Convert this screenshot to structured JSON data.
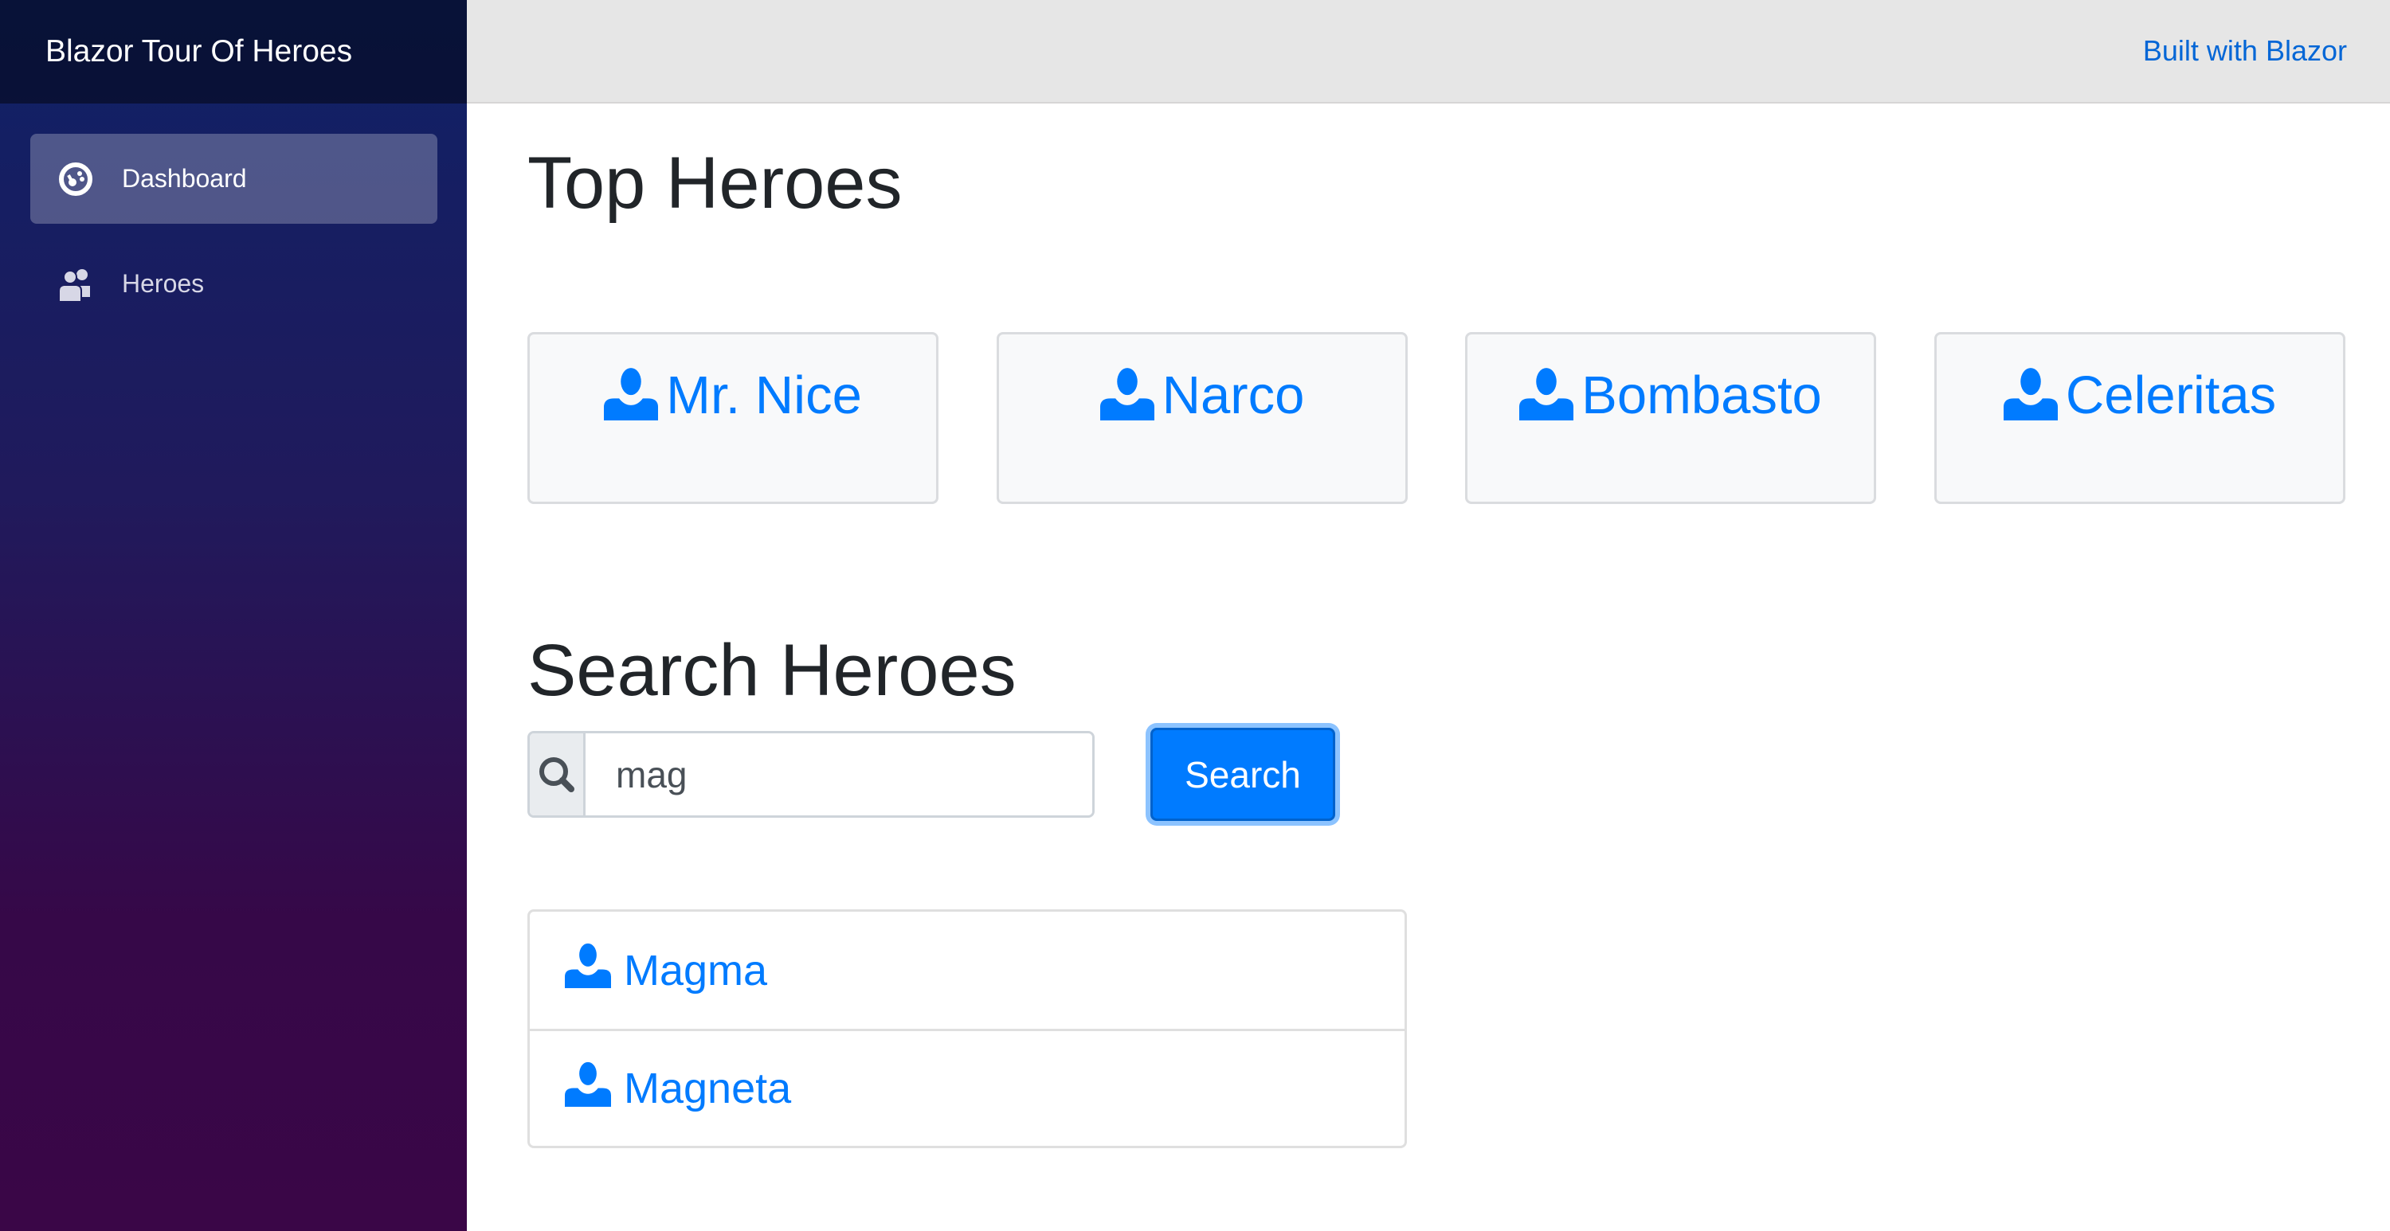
{
  "app": {
    "title": "Blazor Tour Of Heroes",
    "built_with": "Built with Blazor"
  },
  "sidebar": {
    "items": [
      {
        "label": "Dashboard",
        "icon": "dashboard-icon",
        "active": true
      },
      {
        "label": "Heroes",
        "icon": "people-icon",
        "active": false
      }
    ]
  },
  "main": {
    "top_heroes_title": "Top Heroes",
    "top_heroes": [
      {
        "name": "Mr. Nice"
      },
      {
        "name": "Narco"
      },
      {
        "name": "Bombasto"
      },
      {
        "name": "Celeritas"
      }
    ],
    "search_title": "Search Heroes",
    "search": {
      "value": "mag",
      "button_label": "Search",
      "icon": "search-icon"
    },
    "results": [
      {
        "name": "Magma"
      },
      {
        "name": "Magneta"
      }
    ]
  },
  "colors": {
    "accent": "#007bff",
    "link": "#0366d6"
  }
}
